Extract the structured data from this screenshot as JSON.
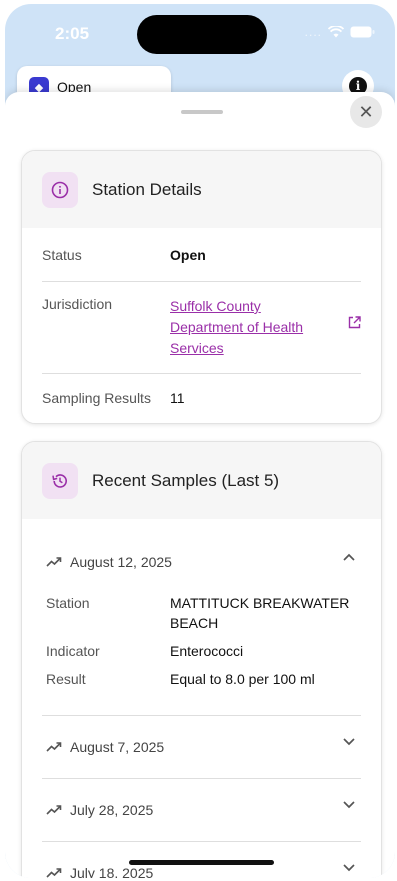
{
  "status_bar": {
    "time": "2:05",
    "signal": "...."
  },
  "background": {
    "chip_label": "Open",
    "info_label": "i"
  },
  "station_details": {
    "title": "Station Details",
    "rows": [
      {
        "label": "Status",
        "value": "Open"
      },
      {
        "label": "Jurisdiction",
        "value_lines": [
          "Suffolk County",
          "Department of Health",
          "Services"
        ]
      },
      {
        "label": "Sampling Results",
        "value": "11"
      }
    ]
  },
  "recent_samples": {
    "title": "Recent Samples (Last 5)",
    "items": [
      {
        "date": "August 12, 2025",
        "expanded": true,
        "fields": [
          {
            "label": "Station",
            "value": "MATTITUCK BREAKWATER BEACH"
          },
          {
            "label": "Indicator",
            "value": "Enterococci"
          },
          {
            "label": "Result",
            "value": "Equal to 8.0 per 100 ml"
          }
        ]
      },
      {
        "date": "August 7, 2025",
        "expanded": false
      },
      {
        "date": "July 28, 2025",
        "expanded": false
      },
      {
        "date": "July 18, 2025",
        "expanded": false
      }
    ]
  },
  "colors": {
    "accent": "#9a2fa8",
    "icon_bg": "#f1e1f3",
    "sky": "#cfe3f7"
  }
}
